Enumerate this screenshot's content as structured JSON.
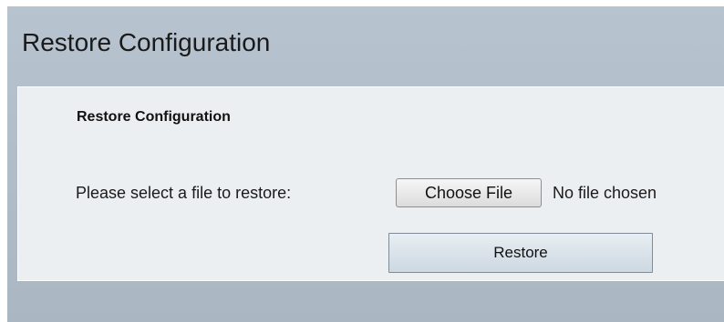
{
  "page": {
    "title": "Restore Configuration"
  },
  "section": {
    "title": "Restore Configuration",
    "file_label": "Please select a file to restore:",
    "choose_file_label": "Choose File",
    "file_status": "No file chosen",
    "restore_label": "Restore"
  }
}
